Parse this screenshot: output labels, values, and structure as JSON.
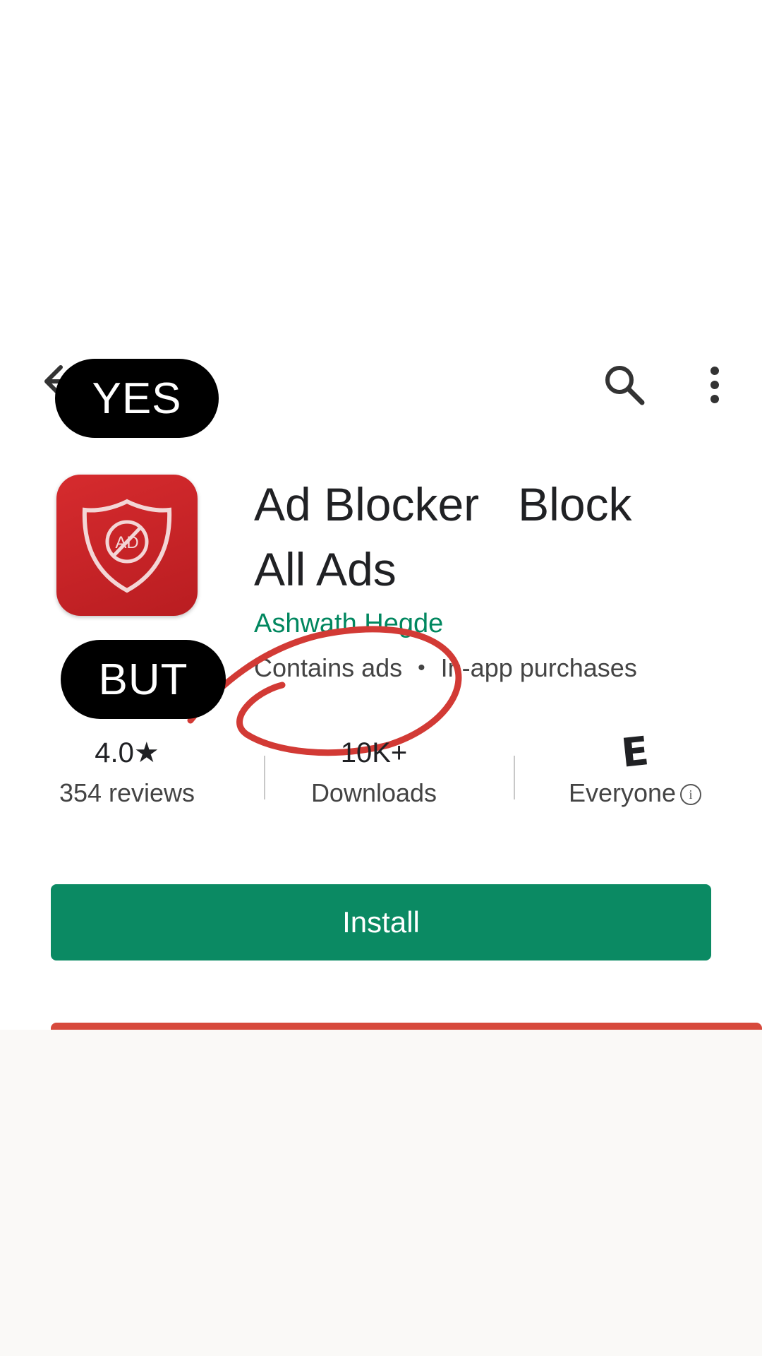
{
  "overlay": {
    "yes_label": "YES",
    "but_label": "BUT"
  },
  "app": {
    "title": "Ad Blocker   Block\nAll Ads",
    "developer": "Ashwath Hegde",
    "contains_ads": "Contains ads",
    "separator": "•",
    "in_app": "In-app purchases",
    "icon_text": "AD"
  },
  "stats": {
    "rating": "4.0★",
    "reviews": "354 reviews",
    "downloads_count": "10K+",
    "downloads_label": "Downloads",
    "content_rating_badge": "E",
    "content_rating_label": "Everyone",
    "info_symbol": "i"
  },
  "actions": {
    "install_label": "Install"
  },
  "colors": {
    "install_green": "#0b8a63",
    "developer_green": "#01875f",
    "icon_red": "#c8262a",
    "annotation_red": "#d23a35"
  },
  "icons": [
    "back-arrow-icon",
    "search-icon",
    "more-vert-icon",
    "app-icon",
    "info-icon",
    "content-rating-icon"
  ]
}
